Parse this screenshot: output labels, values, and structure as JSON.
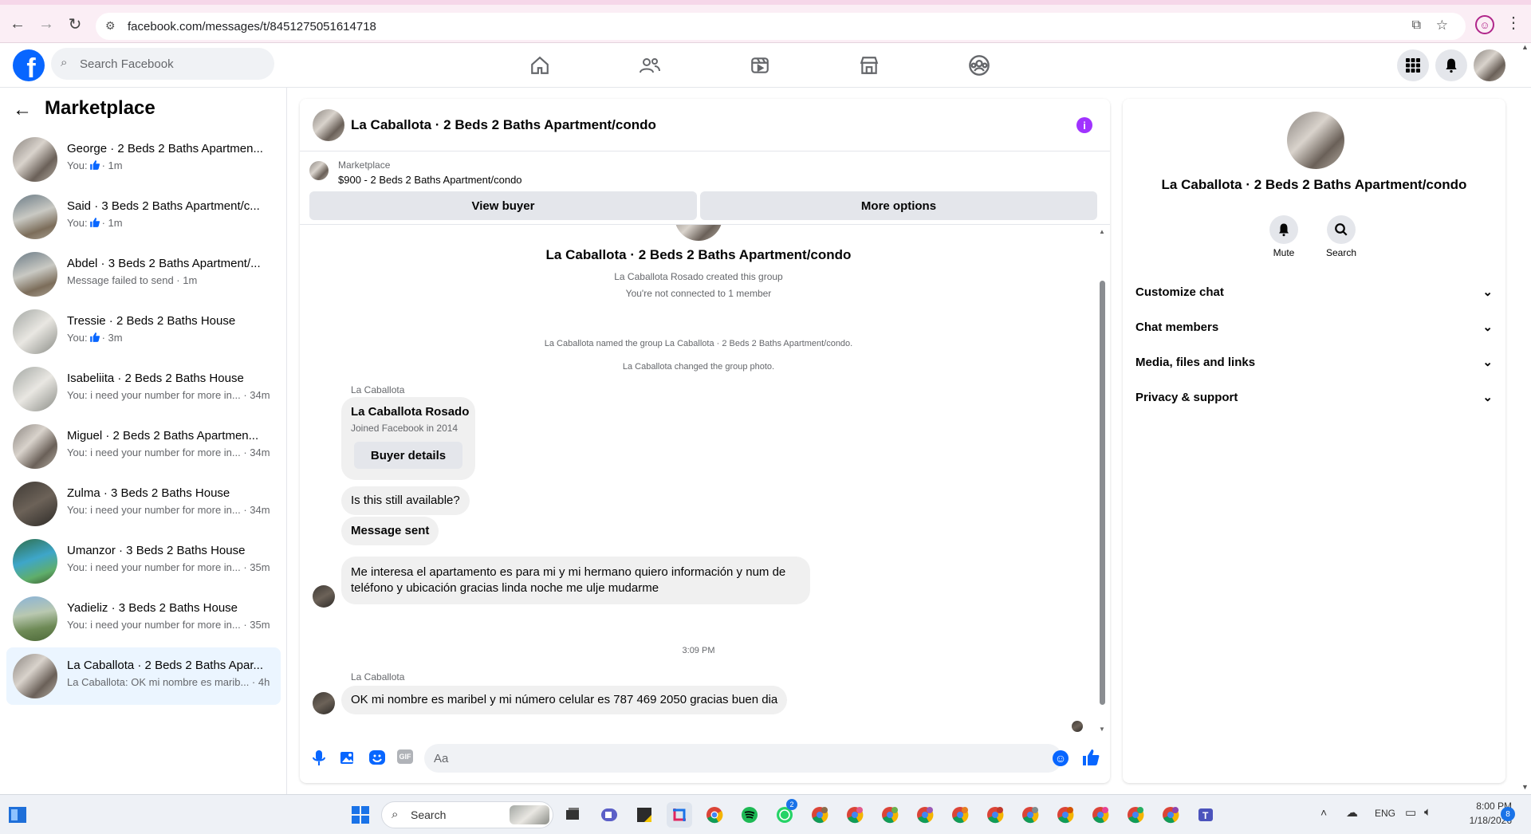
{
  "browser": {
    "url": "facebook.com/messages/t/8451275051614718"
  },
  "header": {
    "search_placeholder": "Search Facebook"
  },
  "sidebar": {
    "title": "Marketplace",
    "conversations": [
      {
        "title": "George · 2 Beds 2 Baths Apartmen...",
        "prefix": "You:",
        "sub": "· 1m",
        "like": true
      },
      {
        "title": "Said · 3 Beds 2 Baths Apartment/c...",
        "prefix": "You:",
        "sub": "· 1m",
        "like": true
      },
      {
        "title": "Abdel · 3 Beds 2 Baths Apartment/...",
        "prefix": "",
        "sub": "Message failed to send · 1m",
        "like": false
      },
      {
        "title": "Tressie · 2 Beds 2 Baths House",
        "prefix": "You:",
        "sub": "· 3m",
        "like": true
      },
      {
        "title": "Isabeliita · 2 Beds 2 Baths House",
        "prefix": "",
        "sub": "You: i need your number for more in... · 34m",
        "like": false
      },
      {
        "title": "Miguel · 2 Beds 2 Baths Apartmen...",
        "prefix": "",
        "sub": "You: i need your number for more in... · 34m",
        "like": false
      },
      {
        "title": "Zulma · 3 Beds 2 Baths House",
        "prefix": "",
        "sub": "You: i need your number for more in... · 34m",
        "like": false
      },
      {
        "title": "Umanzor · 3 Beds 2 Baths House",
        "prefix": "",
        "sub": "You: i need your number for more in... · 35m",
        "like": false
      },
      {
        "title": "Yadieliz · 3 Beds 2 Baths House",
        "prefix": "",
        "sub": "You: i need your number for more in... · 35m",
        "like": false
      },
      {
        "title": "La Caballota · 2 Beds 2 Baths Apar...",
        "prefix": "",
        "sub": "La Caballota: OK mi nombre es marib... · 4h",
        "like": false
      }
    ]
  },
  "chat": {
    "title": "La Caballota · 2 Beds 2 Baths Apartment/condo",
    "listing_label": "Marketplace",
    "listing_detail": "$900 - 2 Beds 2 Baths Apartment/condo",
    "view_buyer": "View buyer",
    "more_options": "More options",
    "group_title": "La Caballota · 2 Beds 2 Baths Apartment/condo",
    "created": "La Caballota Rosado created this group",
    "not_connected": "You're not connected to 1 member",
    "named_group": "La Caballota named the group La Caballota · 2 Beds 2 Baths Apartment/condo.",
    "changed_photo": "La Caballota changed the group photo.",
    "sender1": "La Caballota",
    "card_name": "La Caballota Rosado",
    "card_joined": "Joined Facebook in 2014",
    "buyer_details": "Buyer details",
    "msg_available": "Is this still available?",
    "msg_sent": "Message sent",
    "msg_long_1": "Me interesa el apartamento es para mi y mi hermano quiero información y num de",
    "msg_long_2": "teléfono y ubicación gracias linda noche me ulje mudarme",
    "time": "3:09 PM",
    "sender2": "La Caballota",
    "msg_last": "OK mi nombre es maribel y mi número celular es 787 469 2050 gracias buen dia",
    "input_placeholder": "Aa"
  },
  "info": {
    "title": "La Caballota · 2 Beds 2 Baths Apartment/condo",
    "mute": "Mute",
    "search": "Search",
    "sections": [
      "Customize chat",
      "Chat members",
      "Media, files and links",
      "Privacy & support"
    ]
  },
  "taskbar": {
    "search": "Search",
    "lang": "ENG",
    "time": "8:00 PM",
    "date": "1/18/2026",
    "notif_count": "8",
    "whatsapp_badge": "2"
  },
  "colors": {
    "fb_blue": "#0866ff",
    "info_purple": "#a033ff"
  }
}
